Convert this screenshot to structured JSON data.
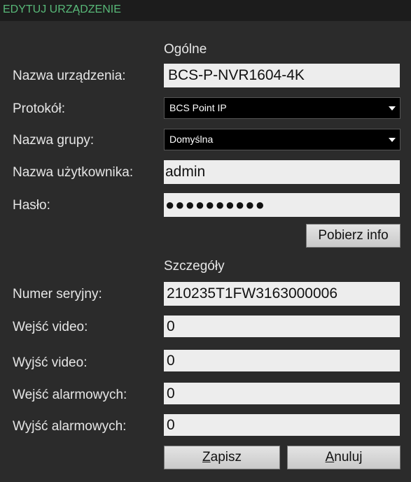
{
  "dialog": {
    "title": "EDYTUJ URZĄDZENIE",
    "title_color": "#58b878"
  },
  "general": {
    "heading": "Ogólne",
    "device_name_label": "Nazwa urządzenia:",
    "device_name_value": "BCS-P-NVR1604-4K",
    "protocol_label": "Protokół:",
    "protocol_value": "BCS Point IP",
    "group_label": "Nazwa grupy:",
    "group_value": "Domyślna",
    "username_label": "Nazwa użytkownika:",
    "username_value": "admin",
    "password_label": "Hasło:",
    "password_value": "●●●●●●●●●●",
    "fetch_info_label": "Pobierz info"
  },
  "details": {
    "heading": "Szczegóły",
    "serial_label": "Numer seryjny:",
    "serial_value": "210235T1FW3163000006",
    "video_in_label": "Wejść video:",
    "video_in_value": "0",
    "video_out_label": "Wyjść video:",
    "video_out_value": "0",
    "alarm_in_label": "Wejść alarmowych:",
    "alarm_in_value": "0",
    "alarm_out_label": "Wyjść alarmowych:",
    "alarm_out_value": "0"
  },
  "actions": {
    "save_first": "Z",
    "save_rest": "apisz",
    "cancel_first": "A",
    "cancel_rest": "nuluj"
  }
}
